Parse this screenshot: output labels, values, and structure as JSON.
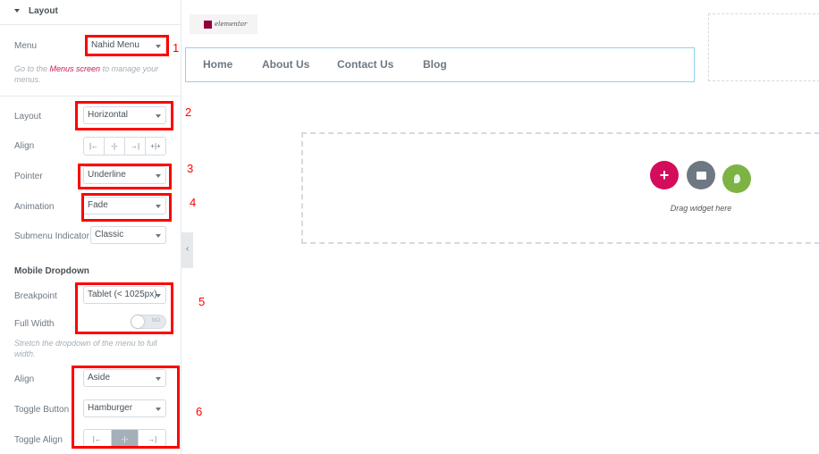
{
  "panel": {
    "section_title": "Layout",
    "menu": {
      "label": "Menu",
      "value": "Nahid Menu"
    },
    "menu_note": {
      "before": "Go to the ",
      "link": "Menus screen",
      "after": " to manage your menus."
    },
    "layout": {
      "label": "Layout",
      "value": "Horizontal"
    },
    "align": {
      "label": "Align",
      "options": [
        "left",
        "center",
        "right",
        "justify"
      ]
    },
    "pointer": {
      "label": "Pointer",
      "value": "Underline"
    },
    "animation": {
      "label": "Animation",
      "value": "Fade"
    },
    "submenu_indicator": {
      "label": "Submenu Indicator",
      "value": "Classic"
    },
    "mobile_heading": "Mobile Dropdown",
    "breakpoint": {
      "label": "Breakpoint",
      "value": "Tablet (< 1025px)"
    },
    "full_width": {
      "label": "Full Width",
      "value": "NO"
    },
    "full_width_note": "Stretch the dropdown of the menu to full width.",
    "mobile_align": {
      "label": "Align",
      "value": "Aside"
    },
    "toggle_button": {
      "label": "Toggle Button",
      "value": "Hamburger"
    },
    "toggle_align": {
      "label": "Toggle Align",
      "options": [
        "left",
        "center",
        "right"
      ],
      "selected": "center"
    }
  },
  "annotations": [
    "1",
    "2",
    "3",
    "4",
    "5",
    "6"
  ],
  "canvas": {
    "logo": "elementor",
    "nav": [
      "Home",
      "About Us",
      "Contact Us",
      "Blog"
    ],
    "drop_text": "Drag widget here"
  },
  "colors": {
    "accent": "#d30c5c",
    "annotation": "#ff0000",
    "folder": "#6d7882",
    "green": "#7cb342"
  }
}
